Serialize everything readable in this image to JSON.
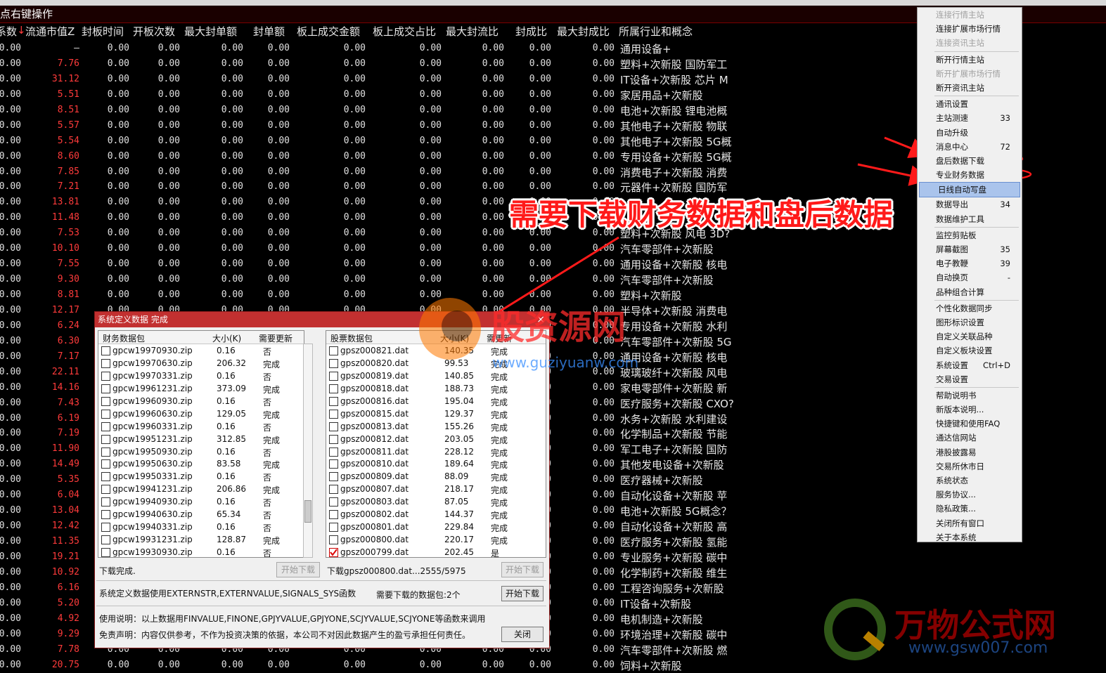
{
  "hint": "点右键操作",
  "columns": [
    "系数",
    "流通市值Z",
    "封板时间",
    "开板次数",
    "最大封单额",
    "封单额",
    "板上成交金额",
    "板上成交占比",
    "最大封流比",
    "封成比",
    "最大封成比",
    "所属行业和概念"
  ],
  "rows": [
    {
      "mv": "—",
      "ind": "通用设备+"
    },
    {
      "mv": "7.76",
      "ind": "塑料+次新股 国防军工"
    },
    {
      "mv": "31.12",
      "ind": "IT设备+次新股 芯片 M"
    },
    {
      "mv": "5.51",
      "ind": "家居用品+次新股"
    },
    {
      "mv": "8.51",
      "ind": "电池+次新股 锂电池概"
    },
    {
      "mv": "5.57",
      "ind": "其他电子+次新股 物联"
    },
    {
      "mv": "5.54",
      "ind": "其他电子+次新股 5G概"
    },
    {
      "mv": "8.60",
      "ind": "专用设备+次新股 5G概"
    },
    {
      "mv": "7.85",
      "ind": "消费电子+次新股 消费"
    },
    {
      "mv": "7.21",
      "ind": "元器件+次新股 国防军"
    },
    {
      "mv": "13.81",
      "ind": ""
    },
    {
      "mv": "11.48",
      "ind": ""
    },
    {
      "mv": "7.53",
      "ind": "塑料+次新股 风电 3D?"
    },
    {
      "mv": "10.10",
      "ind": "汽车零部件+次新股"
    },
    {
      "mv": "7.55",
      "ind": "通用设备+次新股 核电"
    },
    {
      "mv": "9.30",
      "ind": "汽车零部件+次新股"
    },
    {
      "mv": "8.81",
      "ind": "塑料+次新股"
    },
    {
      "mv": "12.17",
      "ind": "半导体+次新股 消费电"
    },
    {
      "mv": "6.24",
      "ind": "专用设备+次新股 水利"
    },
    {
      "mv": "6.30",
      "ind": "汽车零部件+次新股 5G"
    },
    {
      "mv": "7.17",
      "ind": "通用设备+次新股 核电"
    },
    {
      "mv": "22.11",
      "ind": "玻璃玻纤+次新股 风电"
    },
    {
      "mv": "14.16",
      "ind": "家电零部件+次新股 新"
    },
    {
      "mv": "7.43",
      "ind": "医疗服务+次新股 CXO?"
    },
    {
      "mv": "6.19",
      "ind": "水务+次新股 水利建设"
    },
    {
      "mv": "7.19",
      "ind": "化学制品+次新股 节能"
    },
    {
      "mv": "11.90",
      "ind": "军工电子+次新股 国防"
    },
    {
      "mv": "14.49",
      "ind": "其他发电设备+次新股"
    },
    {
      "mv": "5.35",
      "ind": "医疗器械+次新股"
    },
    {
      "mv": "6.04",
      "ind": "自动化设备+次新股 苹"
    },
    {
      "mv": "13.04",
      "ind": "电池+次新股 5G概念？"
    },
    {
      "mv": "12.42",
      "ind": "自动化设备+次新股 高"
    },
    {
      "mv": "11.35",
      "ind": "医疗服务+次新股 氢能"
    },
    {
      "mv": "19.21",
      "ind": "专业服务+次新股 碳中"
    },
    {
      "mv": "10.92",
      "ind": "化学制药+次新股 维生"
    },
    {
      "mv": "6.16",
      "ind": "工程咨询服务+次新股"
    },
    {
      "mv": "5.20",
      "ind": "IT设备+次新股"
    },
    {
      "mv": "4.92",
      "ind": "电机制造+次新股"
    },
    {
      "mv": "9.29",
      "ind": "环境治理+次新股 碳中"
    },
    {
      "mv": "7.78",
      "ind": "汽车零部件+次新股 燃"
    },
    {
      "mv": "20.75",
      "ind": "饲料+次新股"
    }
  ],
  "zero": "0.00",
  "menu": [
    {
      "label": "连接行情主站",
      "dis": true
    },
    {
      "label": "连接扩展市场行情"
    },
    {
      "label": "连接资讯主站",
      "dis": true
    },
    {
      "sep": true
    },
    {
      "label": "断开行情主站"
    },
    {
      "label": "断开扩展市场行情",
      "dis": true
    },
    {
      "label": "断开资讯主站"
    },
    {
      "sep": true
    },
    {
      "label": "通讯设置"
    },
    {
      "label": "主站测速",
      "sc": "33"
    },
    {
      "label": "自动升级"
    },
    {
      "label": "消息中心",
      "sc": "72"
    },
    {
      "label": "盘后数据下载"
    },
    {
      "label": "专业财务数据"
    },
    {
      "label": "日线自动写盘",
      "hl": true
    },
    {
      "label": "数据导出",
      "sc": "34"
    },
    {
      "label": "数据维护工具"
    },
    {
      "sep": true
    },
    {
      "label": "监控剪贴板"
    },
    {
      "label": "屏幕截图",
      "sc": "35"
    },
    {
      "label": "电子教鞭",
      "sc": "39"
    },
    {
      "label": "自动换页",
      "sc": "-"
    },
    {
      "label": "品种组合计算"
    },
    {
      "sep": true
    },
    {
      "label": "个性化数据同步"
    },
    {
      "label": "图形标识设置"
    },
    {
      "label": "自定义关联品种"
    },
    {
      "label": "自定义板块设置"
    },
    {
      "label": "系统设置",
      "sc": "Ctrl+D"
    },
    {
      "label": "交易设置"
    },
    {
      "sep": true
    },
    {
      "label": "帮助说明书"
    },
    {
      "label": "新版本说明..."
    },
    {
      "label": "快捷键和使用FAQ"
    },
    {
      "label": "通达信网站"
    },
    {
      "label": "港股披露易"
    },
    {
      "label": "交易所休市日"
    },
    {
      "label": "系统状态"
    },
    {
      "label": "服务协议..."
    },
    {
      "label": "隐私政策..."
    },
    {
      "label": "关闭所有窗口"
    },
    {
      "label": "关于本系统"
    }
  ],
  "annotation": "需要下载财务数据和盘后数据",
  "dialog": {
    "title": "系统定义数据 完成",
    "close": "×",
    "fin_headers": [
      "财务数据包",
      "大小(K)",
      "需要更新"
    ],
    "fin_rows": [
      [
        "gpcw19970930.zip",
        "0.16",
        "否"
      ],
      [
        "gpcw19970630.zip",
        "206.32",
        "完成"
      ],
      [
        "gpcw19970331.zip",
        "0.16",
        "否"
      ],
      [
        "gpcw19961231.zip",
        "373.09",
        "完成"
      ],
      [
        "gpcw19960930.zip",
        "0.16",
        "否"
      ],
      [
        "gpcw19960630.zip",
        "129.05",
        "完成"
      ],
      [
        "gpcw19960331.zip",
        "0.16",
        "否"
      ],
      [
        "gpcw19951231.zip",
        "312.85",
        "完成"
      ],
      [
        "gpcw19950930.zip",
        "0.16",
        "否"
      ],
      [
        "gpcw19950630.zip",
        "83.58",
        "完成"
      ],
      [
        "gpcw19950331.zip",
        "0.16",
        "否"
      ],
      [
        "gpcw19941231.zip",
        "206.86",
        "完成"
      ],
      [
        "gpcw19940930.zip",
        "0.16",
        "否"
      ],
      [
        "gpcw19940630.zip",
        "65.34",
        "否"
      ],
      [
        "gpcw19940331.zip",
        "0.16",
        "否"
      ],
      [
        "gpcw19931231.zip",
        "128.87",
        "完成"
      ],
      [
        "gpcw19930930.zip",
        "0.16",
        "否"
      ]
    ],
    "stk_headers": [
      "股票数据包",
      "大小(K)",
      "需更新"
    ],
    "stk_rows": [
      [
        "gpsz000821.dat",
        "140.35",
        "完成"
      ],
      [
        "gpsz000820.dat",
        "99.53",
        "完成"
      ],
      [
        "gpsz000819.dat",
        "140.85",
        "完成"
      ],
      [
        "gpsz000818.dat",
        "188.73",
        "完成"
      ],
      [
        "gpsz000816.dat",
        "195.04",
        "完成"
      ],
      [
        "gpsz000815.dat",
        "129.37",
        "完成"
      ],
      [
        "gpsz000813.dat",
        "155.26",
        "完成"
      ],
      [
        "gpsz000812.dat",
        "203.05",
        "完成"
      ],
      [
        "gpsz000811.dat",
        "228.12",
        "完成"
      ],
      [
        "gpsz000810.dat",
        "189.64",
        "完成"
      ],
      [
        "gpsz000809.dat",
        "88.09",
        "完成"
      ],
      [
        "gpsz000807.dat",
        "218.17",
        "完成"
      ],
      [
        "gpsz000803.dat",
        "87.05",
        "完成"
      ],
      [
        "gpsz000802.dat",
        "144.37",
        "完成"
      ],
      [
        "gpsz000801.dat",
        "229.84",
        "完成"
      ],
      [
        "gpsz000800.dat",
        "220.17",
        "完成"
      ],
      [
        "gpsz000799.dat",
        "202.45",
        "是"
      ]
    ],
    "fin_status": "下载完成.",
    "stk_status": "下载gpsz000800.dat...2555/5975",
    "start_btn": "开始下载",
    "sys_note": "系统定义数据使用EXTERNSTR,EXTERNVALUE,SIGNALS_SYS函数",
    "need_count": "需要下载的数据包:2个",
    "usage": "使用说明：以上数据用FINVALUE,FINONE,GPJYVALUE,GPJYONE,SCJYVALUE,SCJYONE等函数来调用",
    "disclaimer": "免责声明：内容仅供参考，不作为投资决策的依据，本公司不对因此数据产生的盈亏承担任何责任。",
    "close_btn": "关闭"
  },
  "watermark1": {
    "cn": "股资源网",
    "url": "www.guziyuanw.com"
  },
  "watermark2": {
    "cn": "万物公式网",
    "url": "www.gsw007.com"
  }
}
